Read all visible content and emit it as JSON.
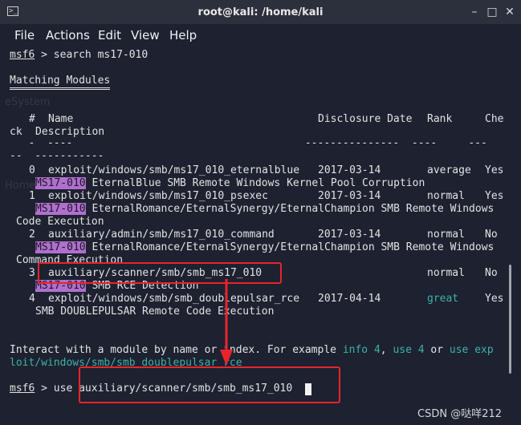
{
  "window": {
    "title": "root@kali: /home/kali",
    "minimize": "–",
    "maximize": "□",
    "close": "✕"
  },
  "menu": [
    "File",
    "Actions",
    "Edit",
    "View",
    "Help"
  ],
  "prompt": {
    "name": "msf6",
    "sep": " > "
  },
  "command1": "search ms17-010",
  "section_title": "Matching Modules",
  "headers": {
    "num": "#",
    "name": "Name",
    "date": "Disclosure Date",
    "rank": "Rank",
    "check_a": "Che",
    "check_b": "ck",
    "desc": "Description"
  },
  "header_rule": "   -  ----                                     ---------------  ----     ---",
  "header_rule2": "--  -----------",
  "rows": [
    {
      "num": "0",
      "name": "exploit/windows/smb/ms17_010_eternalblue",
      "date": "2017-03-14",
      "rank": "average",
      "check": "Yes",
      "hl": "MS17-010",
      "desc": " EternalBlue SMB Remote Windows Kernel Pool Corruption",
      "desc2": ""
    },
    {
      "num": "1",
      "name": "exploit/windows/smb/ms17_010_psexec",
      "date": "2017-03-14",
      "rank": "normal",
      "check": "Yes",
      "hl": "MS17-010",
      "desc": " EternalRomance/EternalSynergy/EternalChampion SMB Remote Windows",
      "desc2": "Code Execution"
    },
    {
      "num": "2",
      "name": "auxiliary/admin/smb/ms17_010_command",
      "date": "2017-03-14",
      "rank": "normal",
      "check": "No",
      "hl": "MS17-010",
      "desc": " EternalRomance/EternalSynergy/EternalChampion SMB Remote Windows",
      "desc2": "Command Execution"
    },
    {
      "num": "3",
      "name": "auxiliary/scanner/smb/smb_ms17_010",
      "date": "",
      "rank": "normal",
      "check": "No",
      "hl": "MS17-010",
      "desc": " SMB RCE Detection",
      "desc2": ""
    },
    {
      "num": "4",
      "name": "exploit/windows/smb/smb_doublepulsar_rce",
      "date": "2017-04-14",
      "rank": "great",
      "check": "Yes",
      "hl": "",
      "desc": "SMB DOUBLEPULSAR Remote Code Execution",
      "desc2": ""
    }
  ],
  "interact": {
    "text": "Interact with a module by name or index. For example ",
    "ex1": "info 4",
    "sep": ", ",
    "ex2": "use 4",
    "or": " or ",
    "ex3a": "use exp",
    "ex3b": "loit/windows/smb/smb_doublepulsar_rce"
  },
  "command2": "use auxiliary/scanner/smb/smb_ms17_010",
  "watermark": "CSDN @哒咩212",
  "ghost": {
    "a": "eSystem",
    "b": "Home"
  },
  "colors": {
    "highlight": "#b06fce",
    "annotation": "#e8252b",
    "great": "#3cb3a7"
  }
}
